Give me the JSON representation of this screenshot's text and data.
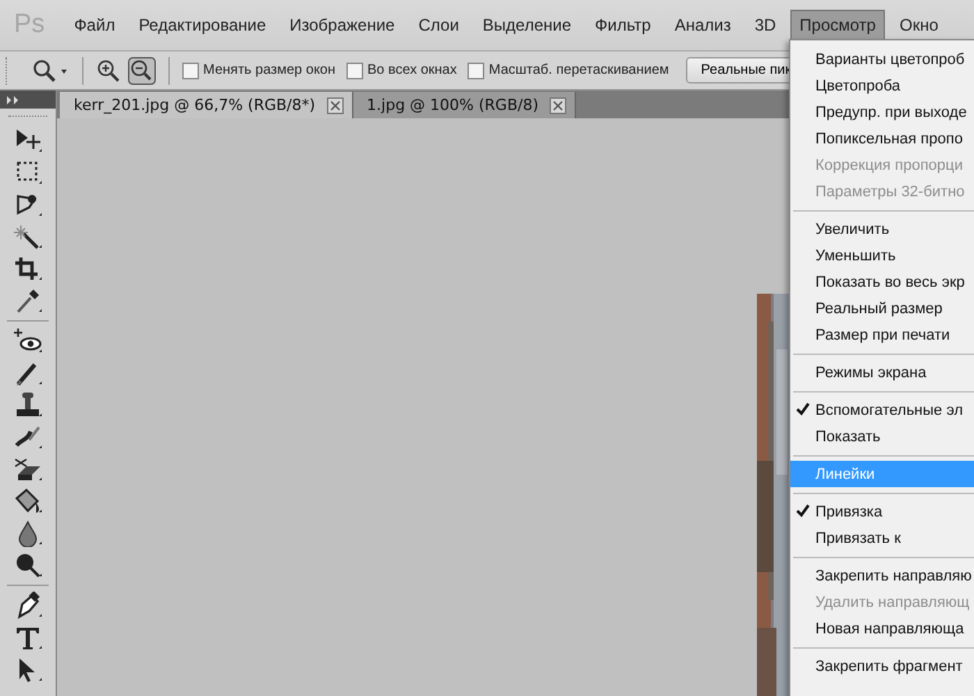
{
  "menubar": {
    "logo": "Ps",
    "items": [
      {
        "label": "Файл",
        "selected": false
      },
      {
        "label": "Редактирование",
        "selected": false
      },
      {
        "label": "Изображение",
        "selected": false
      },
      {
        "label": "Слои",
        "selected": false
      },
      {
        "label": "Выделение",
        "selected": false
      },
      {
        "label": "Фильтр",
        "selected": false
      },
      {
        "label": "Анализ",
        "selected": false
      },
      {
        "label": "3D",
        "selected": false
      },
      {
        "label": "Просмотр",
        "selected": true
      },
      {
        "label": "Окно",
        "selected": false
      }
    ]
  },
  "options_bar": {
    "checkboxes": [
      {
        "label": "Менять размер окон",
        "checked": false
      },
      {
        "label": "Во всех окнах",
        "checked": false
      },
      {
        "label": "Масштаб. перетаскиванием",
        "checked": false
      }
    ],
    "button": "Реальные пик"
  },
  "tabs": [
    {
      "label": "kerr_201.jpg @ 66,7% (RGB/8*)",
      "selected": true
    },
    {
      "label": "1.jpg @ 100% (RGB/8)",
      "selected": false
    }
  ],
  "menu": {
    "groups": [
      [
        {
          "label": "Варианты цветопроб",
          "checked": false,
          "disabled": false,
          "selected": false
        },
        {
          "label": "Цветопроба",
          "checked": false,
          "disabled": false,
          "selected": false
        },
        {
          "label": "Предупр. при выходе",
          "checked": false,
          "disabled": false,
          "selected": false
        },
        {
          "label": "Попиксельная пропо",
          "checked": false,
          "disabled": false,
          "selected": false
        },
        {
          "label": "Коррекция пропорци",
          "checked": false,
          "disabled": true,
          "selected": false
        },
        {
          "label": "Параметры 32-битно",
          "checked": false,
          "disabled": true,
          "selected": false
        }
      ],
      [
        {
          "label": "Увеличить",
          "checked": false,
          "disabled": false,
          "selected": false
        },
        {
          "label": "Уменьшить",
          "checked": false,
          "disabled": false,
          "selected": false
        },
        {
          "label": "Показать во весь экр",
          "checked": false,
          "disabled": false,
          "selected": false
        },
        {
          "label": "Реальный размер",
          "checked": false,
          "disabled": false,
          "selected": false
        },
        {
          "label": "Размер при печати",
          "checked": false,
          "disabled": false,
          "selected": false
        }
      ],
      [
        {
          "label": "Режимы экрана",
          "checked": false,
          "disabled": false,
          "selected": false
        }
      ],
      [
        {
          "label": "Вспомогательные эл",
          "checked": true,
          "disabled": false,
          "selected": false
        },
        {
          "label": "Показать",
          "checked": false,
          "disabled": false,
          "selected": false
        }
      ],
      [
        {
          "label": "Линейки",
          "checked": false,
          "disabled": false,
          "selected": true
        }
      ],
      [
        {
          "label": "Привязка",
          "checked": true,
          "disabled": false,
          "selected": false
        },
        {
          "label": "Привязать к",
          "checked": false,
          "disabled": false,
          "selected": false
        }
      ],
      [
        {
          "label": "Закрепить направляю",
          "checked": false,
          "disabled": false,
          "selected": false
        },
        {
          "label": "Удалить направляющ",
          "checked": false,
          "disabled": true,
          "selected": false
        },
        {
          "label": "Новая направляюща",
          "checked": false,
          "disabled": false,
          "selected": false
        }
      ],
      [
        {
          "label": "Закрепить фрагмент",
          "checked": false,
          "disabled": false,
          "selected": false
        }
      ]
    ]
  }
}
